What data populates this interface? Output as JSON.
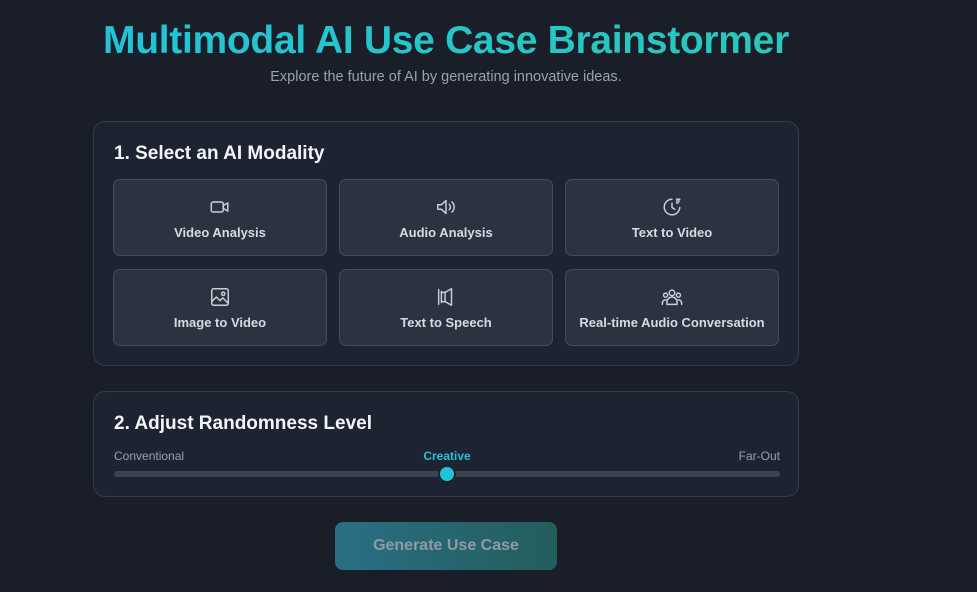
{
  "header": {
    "title": "Multimodal AI Use Case Brainstormer",
    "subtitle": "Explore the future of AI by generating innovative ideas."
  },
  "modality": {
    "heading": "1. Select an AI Modality",
    "options": [
      {
        "label": "Video Analysis",
        "icon": "video-camera-icon"
      },
      {
        "label": "Audio Analysis",
        "icon": "speaker-icon"
      },
      {
        "label": "Text to Video",
        "icon": "sparkle-clock-icon"
      },
      {
        "label": "Image to Video",
        "icon": "image-icon"
      },
      {
        "label": "Text to Speech",
        "icon": "megaphone-icon"
      },
      {
        "label": "Real-time Audio Conversation",
        "icon": "users-icon"
      }
    ]
  },
  "randomness": {
    "heading": "2. Adjust Randomness Level",
    "min_label": "Conventional",
    "current_label": "Creative",
    "max_label": "Far-Out",
    "value_fraction": 0.5
  },
  "actions": {
    "generate_label": "Generate Use Case"
  },
  "colors": {
    "accent": "#22c3d8",
    "background": "#1a1e29",
    "card": "#1e2331",
    "tile": "#2d3241"
  }
}
